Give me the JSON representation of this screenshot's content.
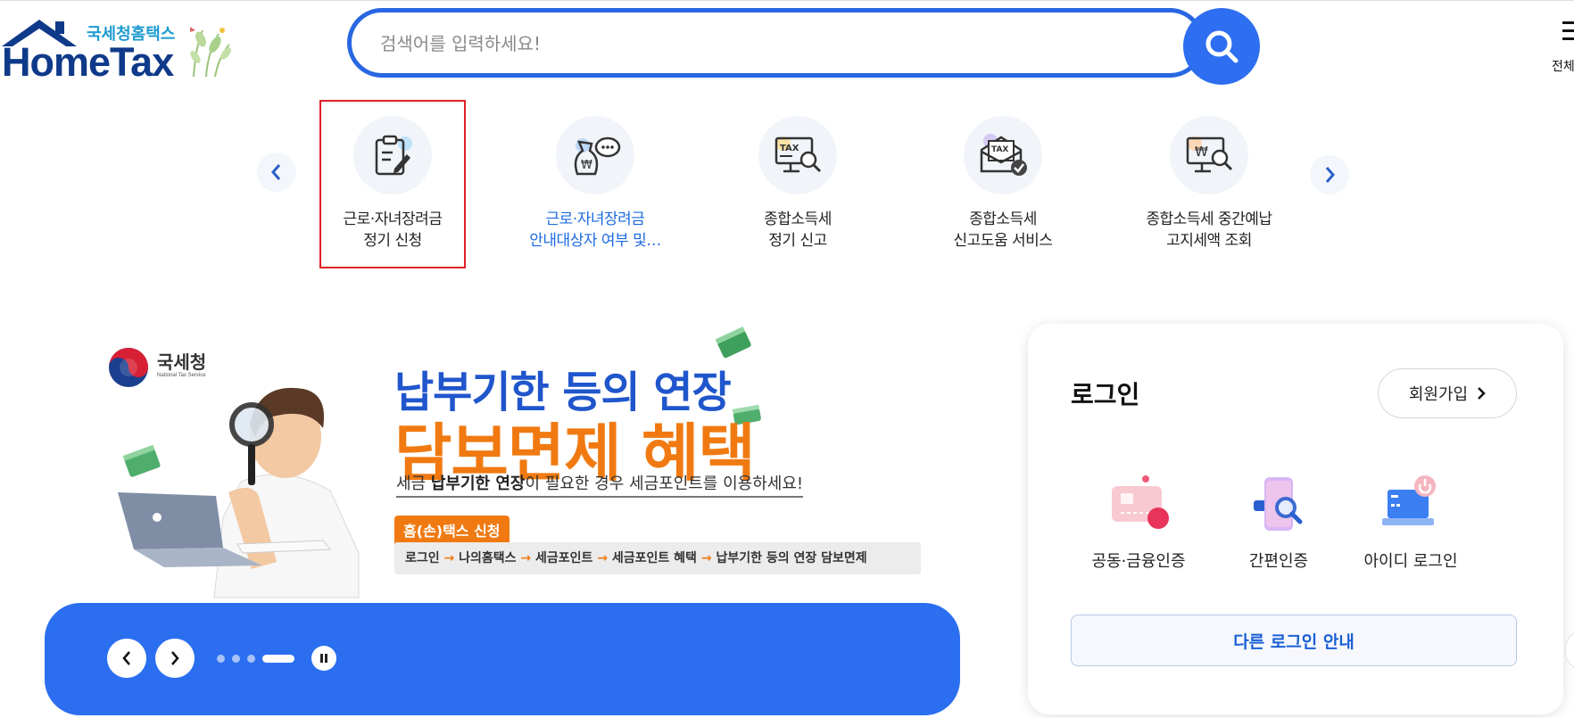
{
  "logo": {
    "korean": "국세청홈택스",
    "english": "HomeTax"
  },
  "search": {
    "placeholder": "검색어를 입력하세요!"
  },
  "header": {
    "menu_label": "전체"
  },
  "quick_menu": [
    {
      "line1": "근로·자녀장려금",
      "line2": "정기 신청",
      "icon": "clipboard-pen-icon"
    },
    {
      "line1": "근로·자녀장려금",
      "line2": "안내대상자 여부 및…",
      "icon": "money-bag-chat-icon"
    },
    {
      "line1": "종합소득세",
      "line2": "정기 신고",
      "icon": "tax-monitor-search-icon"
    },
    {
      "line1": "종합소득세",
      "line2": "신고도움 서비스",
      "icon": "tax-envelope-check-icon"
    },
    {
      "line1": "종합소득세 중간예납",
      "line2": "고지세액 조회",
      "icon": "won-monitor-search-icon"
    }
  ],
  "banner": {
    "org_name": "국세청",
    "org_sub": "National Tax Service",
    "title_line1": "납부기한 등의 연장",
    "title_line2": "담보면제 혜택",
    "desc_pre": "세금 ",
    "desc_bold": "납부기한 연장",
    "desc_post": "이 필요한 경우 세금포인트를 이용하세요!",
    "tag": "홈(손)택스 신청",
    "path": [
      "로그인",
      "나의홈택스",
      "세금포인트",
      "세금포인트 혜택",
      "납부기한 등의 연장 담보면제"
    ],
    "arrow": "→",
    "slide_count": 4,
    "active_slide": 4
  },
  "login": {
    "title": "로그인",
    "join_label": "회원가입",
    "methods": [
      {
        "label": "공동·금융인증",
        "icon": "certificate-card-icon"
      },
      {
        "label": "간편인증",
        "icon": "phone-search-icon"
      },
      {
        "label": "아이디 로그인",
        "icon": "laptop-power-icon"
      }
    ],
    "other_label": "다른 로그인 안내"
  },
  "colors": {
    "brand_blue": "#2b6ff0",
    "orange": "#f07a11",
    "highlight_red": "#e21f26"
  }
}
